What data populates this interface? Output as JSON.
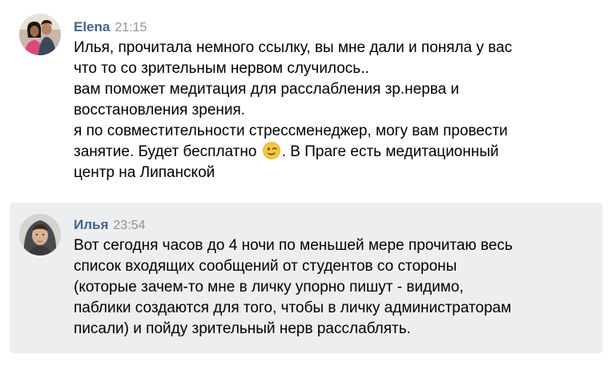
{
  "messages": [
    {
      "author": "Elena",
      "time": "21:15",
      "lines": [
        "Илья, прочитала немного ссылку, вы мне дали и поняла у вас",
        "что то со зрительным нервом случилось..",
        "вам поможет медитация для расслабления зр.нерва и",
        "восстановления зрения.",
        "я по совместительности стрессменеджер, могу вам провести"
      ],
      "line6_before_emoji": "занятие. Будет бесплатно",
      "emoji": "winking-face-emoji",
      "line6_after_emoji": ". В Праге есть медитационный",
      "line7": "центр на Липанской"
    },
    {
      "author": "Илья",
      "time": "23:54",
      "lines": [
        "Вот сегодня часов до 4 ночи по меньшей мере прочитаю весь",
        "список входящих сообщений от студентов со стороны",
        "(которые зачем-то мне в личку упорно пишут - видимо,",
        "паблики создаются для того, чтобы в личку администраторам",
        "писали) и пойду зрительный нерв расслаблять."
      ]
    }
  ],
  "colors": {
    "author": "#42648b",
    "time": "#939393",
    "highlight_bg": "#edeef0"
  }
}
